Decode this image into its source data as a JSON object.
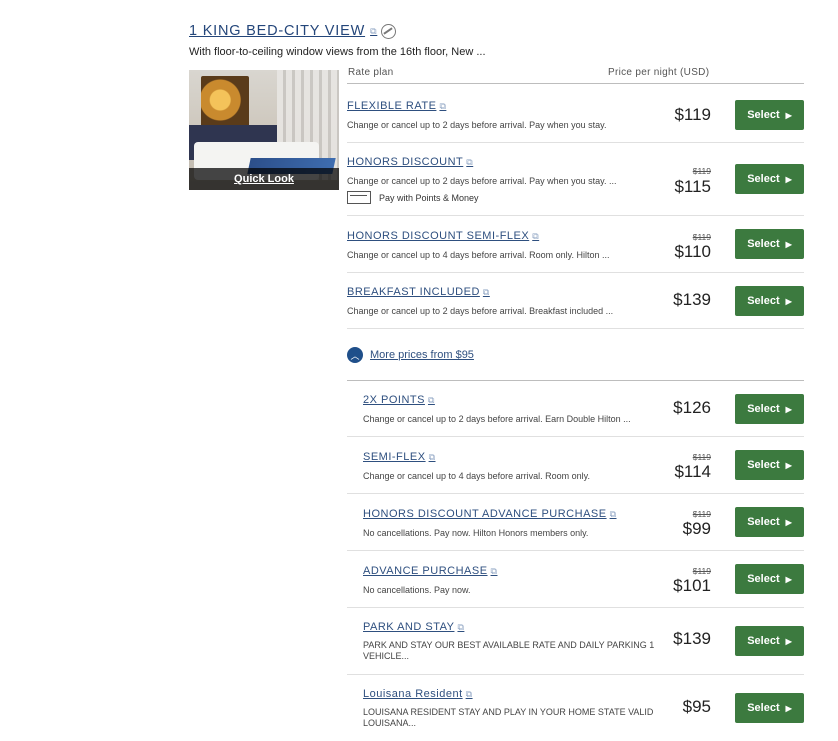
{
  "room": {
    "title": "1 KING BED-CITY VIEW",
    "description": "With floor-to-ceiling window views from the 16th floor, New ...",
    "quick_look": "Quick Look"
  },
  "headers": {
    "rate_plan": "Rate plan",
    "price": "Price per night (USD)"
  },
  "select_label": "Select",
  "more_prices": "More prices from $95",
  "pay_points": "Pay with Points & Money",
  "rates": [
    {
      "name": "FLEXIBLE RATE",
      "desc": "Change or cancel up to 2 days before arrival. Pay when you stay.",
      "strike": "",
      "price": "$119"
    },
    {
      "name": "HONORS DISCOUNT",
      "desc": "Change or cancel up to 2 days before arrival. Pay when you stay. ...",
      "strike": "$119",
      "price": "$115"
    },
    {
      "name": "HONORS DISCOUNT SEMI-FLEX",
      "desc": "Change or cancel up to 4 days before arrival. Room only. Hilton ...",
      "strike": "$119",
      "price": "$110"
    },
    {
      "name": "BREAKFAST INCLUDED",
      "desc": "Change or cancel up to 2 days before arrival. Breakfast included ...",
      "strike": "",
      "price": "$139"
    }
  ],
  "more_rates": [
    {
      "name": "2X POINTS",
      "desc": "Change or cancel up to 2 days before arrival. Earn Double Hilton ...",
      "strike": "",
      "price": "$126"
    },
    {
      "name": "SEMI-FLEX",
      "desc": "Change or cancel up to 4 days before arrival. Room only.",
      "strike": "$119",
      "price": "$114"
    },
    {
      "name": "HONORS DISCOUNT ADVANCE PURCHASE",
      "desc": "No cancellations. Pay now. Hilton Honors members only.",
      "strike": "$119",
      "price": "$99"
    },
    {
      "name": "ADVANCE PURCHASE",
      "desc": "No cancellations. Pay now.",
      "strike": "$119",
      "price": "$101"
    },
    {
      "name": "PARK AND STAY",
      "desc": "PARK AND STAY OUR BEST AVAILABLE RATE AND DAILY PARKING 1 VEHICLE...",
      "strike": "",
      "price": "$139"
    },
    {
      "name": "Louisana Resident",
      "desc": "LOUISANA RESIDENT STAY AND PLAY IN YOUR HOME STATE VALID LOUISANA...",
      "strike": "",
      "price": "$95"
    }
  ]
}
